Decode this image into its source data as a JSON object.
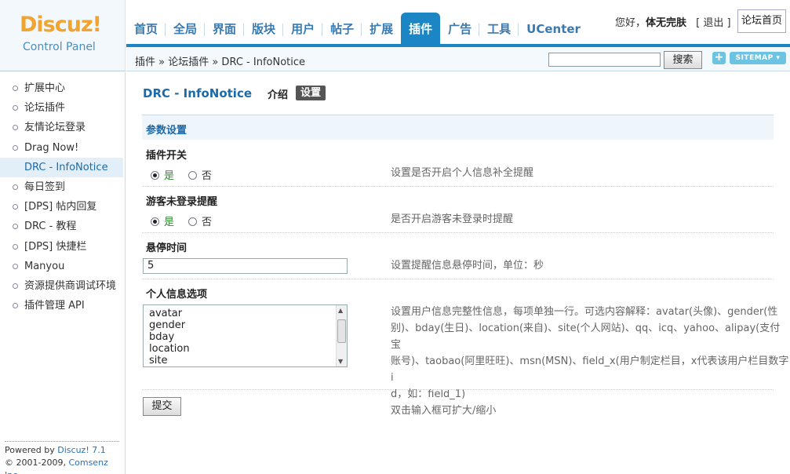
{
  "logo": {
    "title": "Discuz!",
    "subtitle": "Control Panel"
  },
  "nav": {
    "items": [
      {
        "label": "首页"
      },
      {
        "label": "全局"
      },
      {
        "label": "界面"
      },
      {
        "label": "版块"
      },
      {
        "label": "用户"
      },
      {
        "label": "帖子"
      },
      {
        "label": "扩展"
      },
      {
        "label": "插件"
      },
      {
        "label": "广告"
      },
      {
        "label": "工具"
      },
      {
        "label": "UCenter"
      }
    ],
    "active": "插件"
  },
  "user": {
    "greeting": "您好，",
    "name": "体无完肤",
    "logout": "[ 退出 ]",
    "forum_home": "论坛首页"
  },
  "breadcrumb": "插件 » 论坛插件 » DRC - InfoNotice",
  "search": {
    "value": "",
    "button": "搜索"
  },
  "toolbar": {
    "plus": "+",
    "sitemap": "SITEMAP ▾"
  },
  "sidebar": {
    "items": [
      {
        "label": "扩展中心"
      },
      {
        "label": "论坛插件"
      },
      {
        "label": "友情论坛登录"
      },
      {
        "label": "Drag Now!"
      },
      {
        "label": "DRC - InfoNotice",
        "active": true
      },
      {
        "label": "每日签到"
      },
      {
        "label": "[DPS] 帖内回复"
      },
      {
        "label": "DRC - 教程"
      },
      {
        "label": "[DPS] 快捷栏"
      },
      {
        "label": "Manyou"
      },
      {
        "label": "资源提供商调试环境"
      },
      {
        "label": "插件管理 API"
      }
    ],
    "footer_powered": "Powered by ",
    "footer_product": "Discuz! 7.1",
    "footer_copy": "© 2001-2009, ",
    "footer_company": "Comsenz Inc."
  },
  "main": {
    "plugin_title": "DRC - InfoNotice",
    "tab_intro": "介绍",
    "tab_settings": "设置",
    "section_title": "参数设置",
    "plugin_switch": {
      "label": "插件开关",
      "yes": "是",
      "no": "否",
      "value": "是",
      "desc": "设置是否开启个人信息补全提醒"
    },
    "guest_notice": {
      "label": "游客未登录提醒",
      "yes": "是",
      "no": "否",
      "value": "是",
      "desc": "是否开启游客未登录时提醒"
    },
    "hover_time": {
      "label": "悬停时间",
      "value": "5",
      "desc": "设置提醒信息悬停时间，单位：秒"
    },
    "profile_options": {
      "label": "个人信息选项",
      "lines": [
        "avatar",
        "gender",
        "bday",
        "location",
        "site"
      ],
      "desc_lines": [
        "设置用户信息完整性信息，每项单独一行。可选内容解释：avatar(头像)、gender(性",
        "别)、bday(生日)、location(来自)、site(个人网站)、qq、icq、yahoo、alipay(支付宝",
        "账号)、taobao(阿里旺旺)、msn(MSN)、field_x(用户制定栏目，x代表该用户栏目数字i",
        "d，如：field_1)",
        "双击输入框可扩大/缩小"
      ]
    },
    "submit": "提交"
  },
  "colors": {
    "accent": "#1b86c3",
    "link": "#1c6aa8",
    "logo": "#f2a430"
  }
}
